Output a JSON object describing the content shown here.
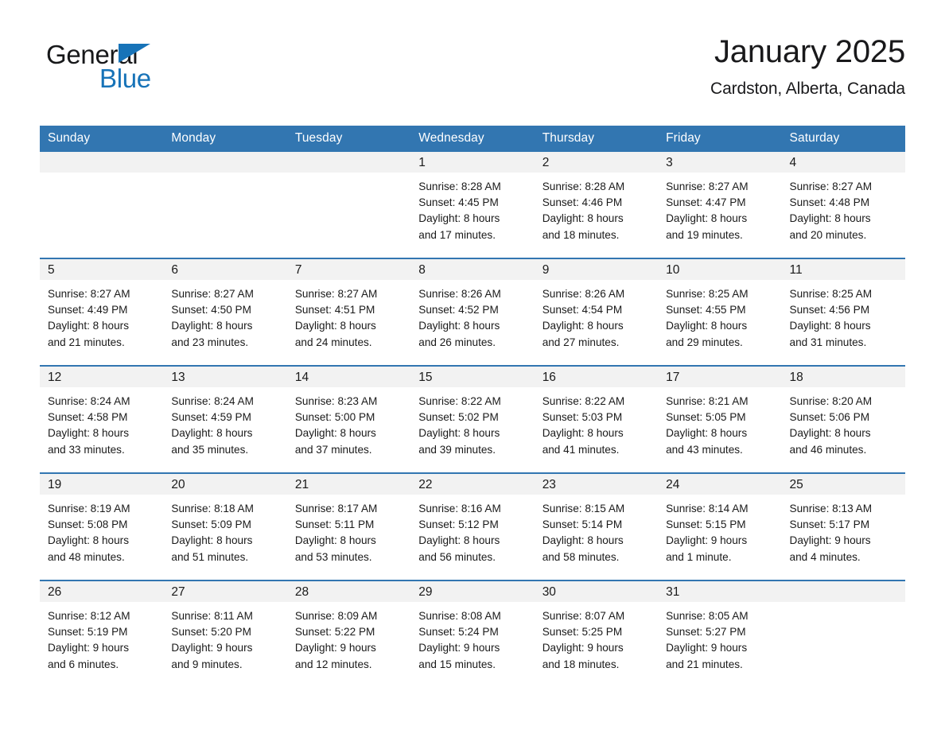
{
  "brand": {
    "name_part1": "General",
    "name_part2": "Blue",
    "accent_color": "#1773b8"
  },
  "header": {
    "title": "January 2025",
    "location": "Cardston, Alberta, Canada"
  },
  "theme": {
    "header_blue": "#3276b1",
    "daynum_band": "#f2f2f2",
    "text": "#1a1a1a"
  },
  "weekday_headers": [
    "Sunday",
    "Monday",
    "Tuesday",
    "Wednesday",
    "Thursday",
    "Friday",
    "Saturday"
  ],
  "weeks": [
    [
      {
        "day": "",
        "empty": true
      },
      {
        "day": "",
        "empty": true
      },
      {
        "day": "",
        "empty": true
      },
      {
        "day": "1",
        "sunrise": "Sunrise: 8:28 AM",
        "sunset": "Sunset: 4:45 PM",
        "daylight1": "Daylight: 8 hours",
        "daylight2": "and 17 minutes."
      },
      {
        "day": "2",
        "sunrise": "Sunrise: 8:28 AM",
        "sunset": "Sunset: 4:46 PM",
        "daylight1": "Daylight: 8 hours",
        "daylight2": "and 18 minutes."
      },
      {
        "day": "3",
        "sunrise": "Sunrise: 8:27 AM",
        "sunset": "Sunset: 4:47 PM",
        "daylight1": "Daylight: 8 hours",
        "daylight2": "and 19 minutes."
      },
      {
        "day": "4",
        "sunrise": "Sunrise: 8:27 AM",
        "sunset": "Sunset: 4:48 PM",
        "daylight1": "Daylight: 8 hours",
        "daylight2": "and 20 minutes."
      }
    ],
    [
      {
        "day": "5",
        "sunrise": "Sunrise: 8:27 AM",
        "sunset": "Sunset: 4:49 PM",
        "daylight1": "Daylight: 8 hours",
        "daylight2": "and 21 minutes."
      },
      {
        "day": "6",
        "sunrise": "Sunrise: 8:27 AM",
        "sunset": "Sunset: 4:50 PM",
        "daylight1": "Daylight: 8 hours",
        "daylight2": "and 23 minutes."
      },
      {
        "day": "7",
        "sunrise": "Sunrise: 8:27 AM",
        "sunset": "Sunset: 4:51 PM",
        "daylight1": "Daylight: 8 hours",
        "daylight2": "and 24 minutes."
      },
      {
        "day": "8",
        "sunrise": "Sunrise: 8:26 AM",
        "sunset": "Sunset: 4:52 PM",
        "daylight1": "Daylight: 8 hours",
        "daylight2": "and 26 minutes."
      },
      {
        "day": "9",
        "sunrise": "Sunrise: 8:26 AM",
        "sunset": "Sunset: 4:54 PM",
        "daylight1": "Daylight: 8 hours",
        "daylight2": "and 27 minutes."
      },
      {
        "day": "10",
        "sunrise": "Sunrise: 8:25 AM",
        "sunset": "Sunset: 4:55 PM",
        "daylight1": "Daylight: 8 hours",
        "daylight2": "and 29 minutes."
      },
      {
        "day": "11",
        "sunrise": "Sunrise: 8:25 AM",
        "sunset": "Sunset: 4:56 PM",
        "daylight1": "Daylight: 8 hours",
        "daylight2": "and 31 minutes."
      }
    ],
    [
      {
        "day": "12",
        "sunrise": "Sunrise: 8:24 AM",
        "sunset": "Sunset: 4:58 PM",
        "daylight1": "Daylight: 8 hours",
        "daylight2": "and 33 minutes."
      },
      {
        "day": "13",
        "sunrise": "Sunrise: 8:24 AM",
        "sunset": "Sunset: 4:59 PM",
        "daylight1": "Daylight: 8 hours",
        "daylight2": "and 35 minutes."
      },
      {
        "day": "14",
        "sunrise": "Sunrise: 8:23 AM",
        "sunset": "Sunset: 5:00 PM",
        "daylight1": "Daylight: 8 hours",
        "daylight2": "and 37 minutes."
      },
      {
        "day": "15",
        "sunrise": "Sunrise: 8:22 AM",
        "sunset": "Sunset: 5:02 PM",
        "daylight1": "Daylight: 8 hours",
        "daylight2": "and 39 minutes."
      },
      {
        "day": "16",
        "sunrise": "Sunrise: 8:22 AM",
        "sunset": "Sunset: 5:03 PM",
        "daylight1": "Daylight: 8 hours",
        "daylight2": "and 41 minutes."
      },
      {
        "day": "17",
        "sunrise": "Sunrise: 8:21 AM",
        "sunset": "Sunset: 5:05 PM",
        "daylight1": "Daylight: 8 hours",
        "daylight2": "and 43 minutes."
      },
      {
        "day": "18",
        "sunrise": "Sunrise: 8:20 AM",
        "sunset": "Sunset: 5:06 PM",
        "daylight1": "Daylight: 8 hours",
        "daylight2": "and 46 minutes."
      }
    ],
    [
      {
        "day": "19",
        "sunrise": "Sunrise: 8:19 AM",
        "sunset": "Sunset: 5:08 PM",
        "daylight1": "Daylight: 8 hours",
        "daylight2": "and 48 minutes."
      },
      {
        "day": "20",
        "sunrise": "Sunrise: 8:18 AM",
        "sunset": "Sunset: 5:09 PM",
        "daylight1": "Daylight: 8 hours",
        "daylight2": "and 51 minutes."
      },
      {
        "day": "21",
        "sunrise": "Sunrise: 8:17 AM",
        "sunset": "Sunset: 5:11 PM",
        "daylight1": "Daylight: 8 hours",
        "daylight2": "and 53 minutes."
      },
      {
        "day": "22",
        "sunrise": "Sunrise: 8:16 AM",
        "sunset": "Sunset: 5:12 PM",
        "daylight1": "Daylight: 8 hours",
        "daylight2": "and 56 minutes."
      },
      {
        "day": "23",
        "sunrise": "Sunrise: 8:15 AM",
        "sunset": "Sunset: 5:14 PM",
        "daylight1": "Daylight: 8 hours",
        "daylight2": "and 58 minutes."
      },
      {
        "day": "24",
        "sunrise": "Sunrise: 8:14 AM",
        "sunset": "Sunset: 5:15 PM",
        "daylight1": "Daylight: 9 hours",
        "daylight2": "and 1 minute."
      },
      {
        "day": "25",
        "sunrise": "Sunrise: 8:13 AM",
        "sunset": "Sunset: 5:17 PM",
        "daylight1": "Daylight: 9 hours",
        "daylight2": "and 4 minutes."
      }
    ],
    [
      {
        "day": "26",
        "sunrise": "Sunrise: 8:12 AM",
        "sunset": "Sunset: 5:19 PM",
        "daylight1": "Daylight: 9 hours",
        "daylight2": "and 6 minutes."
      },
      {
        "day": "27",
        "sunrise": "Sunrise: 8:11 AM",
        "sunset": "Sunset: 5:20 PM",
        "daylight1": "Daylight: 9 hours",
        "daylight2": "and 9 minutes."
      },
      {
        "day": "28",
        "sunrise": "Sunrise: 8:09 AM",
        "sunset": "Sunset: 5:22 PM",
        "daylight1": "Daylight: 9 hours",
        "daylight2": "and 12 minutes."
      },
      {
        "day": "29",
        "sunrise": "Sunrise: 8:08 AM",
        "sunset": "Sunset: 5:24 PM",
        "daylight1": "Daylight: 9 hours",
        "daylight2": "and 15 minutes."
      },
      {
        "day": "30",
        "sunrise": "Sunrise: 8:07 AM",
        "sunset": "Sunset: 5:25 PM",
        "daylight1": "Daylight: 9 hours",
        "daylight2": "and 18 minutes."
      },
      {
        "day": "31",
        "sunrise": "Sunrise: 8:05 AM",
        "sunset": "Sunset: 5:27 PM",
        "daylight1": "Daylight: 9 hours",
        "daylight2": "and 21 minutes."
      },
      {
        "day": "",
        "empty": true
      }
    ]
  ]
}
